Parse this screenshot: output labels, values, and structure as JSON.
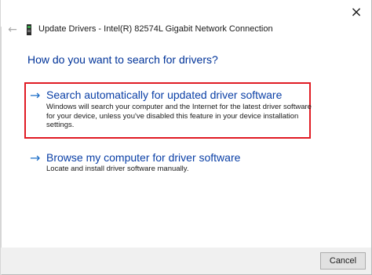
{
  "window": {
    "title": "Update Drivers - Intel(R) 82574L Gigabit Network Connection",
    "close_icon": "×",
    "back_icon": "←",
    "device_icon": "network-adapter-icon"
  },
  "main": {
    "heading": "How do you want to search for drivers?",
    "options": [
      {
        "arrow": "→",
        "title": "Search automatically for updated driver software",
        "desc_lines": [
          "Windows will search your computer and the Internet for the latest driver software",
          "for your device, unless you've disabled this feature in your device installation",
          "settings."
        ],
        "highlighted": true,
        "highlight_color": "#e01b24"
      },
      {
        "arrow": "→",
        "title": "Browse my computer for driver software",
        "desc_lines": [
          "Locate and install driver software manually."
        ],
        "highlighted": false
      }
    ]
  },
  "footer": {
    "cancel_label": "Cancel"
  },
  "colors": {
    "heading": "#003399",
    "link": "#0a3fa6",
    "arrow": "#1e6fc8",
    "footer_bg": "#f0f0f0"
  }
}
